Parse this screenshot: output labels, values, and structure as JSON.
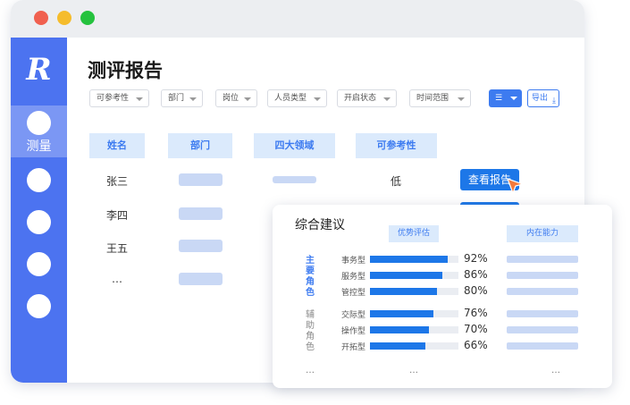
{
  "sidebar": {
    "logo": "R",
    "active_label": "测量"
  },
  "page": {
    "title": "测评报告"
  },
  "filters": [
    "可参考性",
    "部门",
    "岗位",
    "人员类型",
    "开启状态",
    "时间范围"
  ],
  "toolbar": {
    "export_label": "导出"
  },
  "table": {
    "headers": [
      "姓名",
      "部门",
      "四大领域",
      "可参考性"
    ],
    "rows": [
      {
        "name": "张三",
        "reference": "低",
        "action": "查看报告"
      },
      {
        "name": "李四"
      },
      {
        "name": "王五"
      },
      {
        "name": "…"
      }
    ]
  },
  "card": {
    "title": "综合建议",
    "col_strength": "优势评估",
    "col_capability": "内在能力",
    "primary_role": "主要角色",
    "secondary_role": "辅助角色",
    "primary_items": [
      {
        "label": "事务型",
        "value": 92,
        "pct": "92%"
      },
      {
        "label": "服务型",
        "value": 86,
        "pct": "86%"
      },
      {
        "label": "管控型",
        "value": 80,
        "pct": "80%"
      }
    ],
    "secondary_items": [
      {
        "label": "交际型",
        "value": 76,
        "pct": "76%"
      },
      {
        "label": "操作型",
        "value": 70,
        "pct": "70%"
      },
      {
        "label": "开拓型",
        "value": 66,
        "pct": "66%"
      }
    ],
    "ellipsis": "…"
  },
  "colors": {
    "sidebar": "#4c73f0",
    "accent": "#1d77e8",
    "header_bg": "#dbeafc",
    "cursor": "#f47a3c"
  }
}
